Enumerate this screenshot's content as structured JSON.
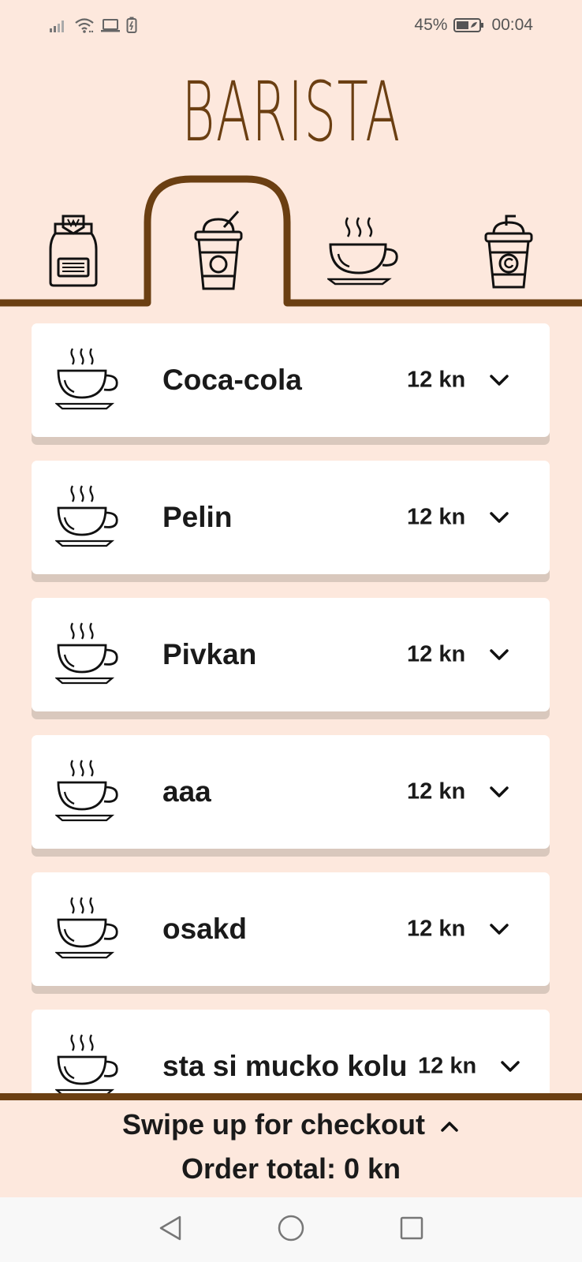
{
  "status_bar": {
    "battery_percent": "45%",
    "time": "00:04",
    "icons": [
      "signal-icon",
      "wifi-icon",
      "laptop-icon",
      "battery-saver-icon",
      "battery-icon"
    ]
  },
  "app": {
    "logo_text": "BARISTA",
    "brand_color": "#6b3f12",
    "background_color": "#fde8dd"
  },
  "category_tabs": [
    {
      "icon": "coffee-bag-icon",
      "selected": false
    },
    {
      "icon": "frappe-cup-icon",
      "selected": true
    },
    {
      "icon": "hot-coffee-cup-icon",
      "selected": false
    },
    {
      "icon": "iced-drink-cup-icon",
      "selected": false
    }
  ],
  "products": [
    {
      "name": "Coca-cola",
      "price": "12 kn",
      "icon": "coffee-cup-icon"
    },
    {
      "name": "Pelin",
      "price": "12 kn",
      "icon": "coffee-cup-icon"
    },
    {
      "name": "Pivkan",
      "price": "12 kn",
      "icon": "coffee-cup-icon"
    },
    {
      "name": "aaa",
      "price": "12 kn",
      "icon": "coffee-cup-icon"
    },
    {
      "name": "osakd",
      "price": "12 kn",
      "icon": "coffee-cup-icon"
    },
    {
      "name": "sta si mucko kolu",
      "price": "12 kn",
      "icon": "coffee-cup-icon"
    }
  ],
  "checkout": {
    "swipe_label": "Swipe up for checkout",
    "total_label": "Order total: 0 kn"
  },
  "nav_bar": {
    "buttons": [
      "back-icon",
      "home-icon",
      "recents-icon"
    ]
  }
}
